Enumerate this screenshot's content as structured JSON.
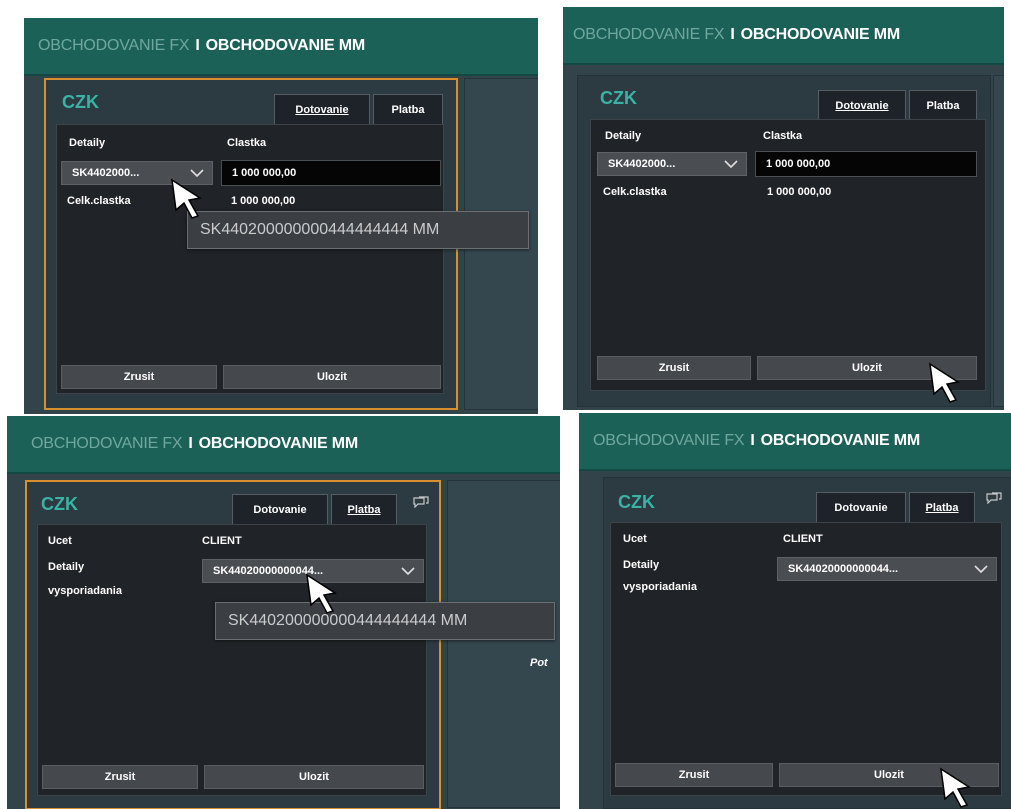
{
  "header": {
    "fx": "OBCHODOVANIE FX",
    "sep": "I",
    "mm": "OBCHODOVANIE MM"
  },
  "card": {
    "currency": "CZK",
    "tabs": {
      "dotovanie": "Dotovanie",
      "platba": "Platba"
    },
    "buttons": {
      "cancel": "Zrusit",
      "save": "Ulozit"
    }
  },
  "dotovanie": {
    "col_detaily": "Detaily",
    "col_clastka": "Clastka",
    "account_short_1": "SK4402000...",
    "account_short_2": "SK4402000...",
    "amount": "1 000 000,00",
    "total_label": "Celk.clastka",
    "total_value": "1 000 000,00"
  },
  "platba": {
    "ucet_label": "Ucet",
    "ucet_value": "CLIENT",
    "detaily_label": "Detaily",
    "vysporiadania_label": "vysporiadania",
    "account_short": "SK44020000000044..."
  },
  "tooltip": {
    "full_account": "SK440200000000444444444 MM"
  },
  "partial_text": {
    "pot": "Pot"
  },
  "colors": {
    "header_bg": "#1c6157",
    "accent_teal": "#3ab2a5",
    "selection_orange": "#d88f2e",
    "panel_bg": "#202327"
  },
  "icons": [
    "chevron-down-icon",
    "chat-icon",
    "mouse-cursor-icon"
  ]
}
